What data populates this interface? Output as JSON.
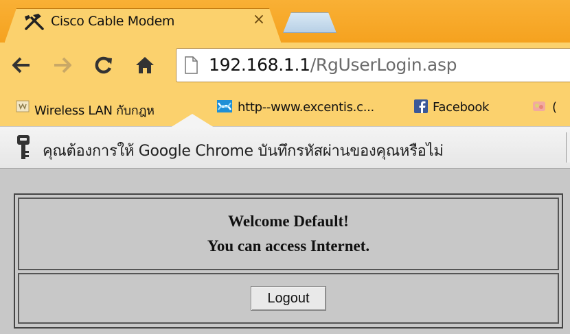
{
  "tabs": [
    {
      "title": "Cisco Cable Modem",
      "icon": "tools-icon",
      "active": true
    },
    {
      "title": "",
      "icon": "new-tab",
      "active": false
    }
  ],
  "tab_close": "×",
  "address": {
    "host": "192.168.1.1",
    "path": "/RgUserLogin.asp"
  },
  "bookmarks": [
    {
      "label": "Wireless LAN กับกฎห",
      "icon": "wifi-bookmark-icon"
    },
    {
      "label": "http--www.excentis.c...",
      "icon": "excentis-icon"
    },
    {
      "label": "Facebook",
      "icon": "facebook-icon"
    },
    {
      "label": "(",
      "icon": "folder-icon"
    }
  ],
  "infobar": {
    "text": "คุณต้องการให้ Google Chrome บันทึกรหัสผ่านของคุณหรือไม่"
  },
  "content": {
    "welcome_line1": "Welcome Default!",
    "welcome_line2": "You can access Internet.",
    "logout_label": "Logout"
  },
  "colors": {
    "tab_bar": "#f5a21f",
    "toolbar": "#fbd16d",
    "page_bg": "#c8c8c8"
  }
}
